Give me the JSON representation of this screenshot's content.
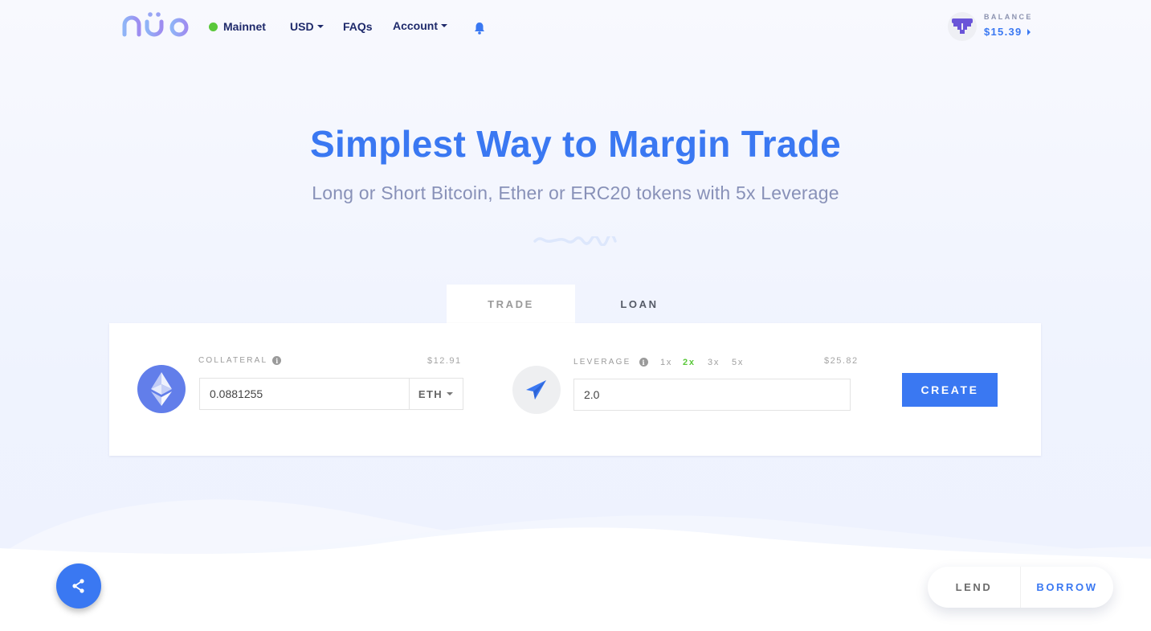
{
  "header": {
    "logo_text": "nuo",
    "network": {
      "label": "Mainnet",
      "status_color": "#5ac83a"
    },
    "currency": {
      "label": "USD"
    },
    "faqs_label": "FAQs",
    "account_label": "Account",
    "balance": {
      "label": "BALANCE",
      "value": "$15.39"
    }
  },
  "hero": {
    "title": "Simplest Way to Margin Trade",
    "subtitle": "Long or Short Bitcoin, Ether or ERC20 tokens with 5x Leverage"
  },
  "tabs": [
    {
      "label": "TRADE",
      "active": true
    },
    {
      "label": "LOAN",
      "active": false
    }
  ],
  "trade_form": {
    "collateral": {
      "label": "COLLATERAL",
      "info_icon": "i",
      "usd_value": "$12.91",
      "amount": "0.0881255",
      "token": "ETH"
    },
    "leverage": {
      "label": "LEVERAGE",
      "info_icon": "i",
      "options": [
        "1x",
        "2x",
        "3x",
        "5x"
      ],
      "selected": "2x",
      "usd_value": "$25.82",
      "value": "2.0"
    },
    "create_label": "CREATE"
  },
  "bottom_toggle": {
    "lend_label": "LEND",
    "borrow_label": "BORROW",
    "active": "BORROW"
  },
  "colors": {
    "accent": "#3a78f2",
    "success": "#5ac83a",
    "eth": "#627eea",
    "nav_text": "#1f2a6b"
  }
}
